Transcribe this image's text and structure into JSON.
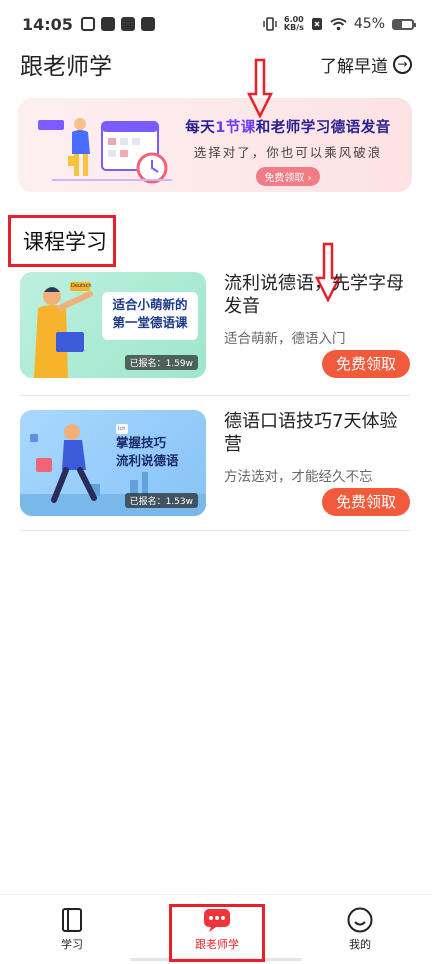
{
  "status": {
    "time": "14:05",
    "speed_value": "6.00",
    "speed_unit": "KB/s",
    "battery": "45%",
    "battery_level": 0.45
  },
  "header": {
    "title": "跟老师学",
    "morning_link": "了解早道"
  },
  "banner": {
    "headline_pre": "每天",
    "headline_highlight": "1节课",
    "headline_post": "和老师学习德语发音",
    "subline": "选择对了，你也可以乘风破浪",
    "button": "免费领取"
  },
  "section": {
    "title": "课程学习"
  },
  "courses": [
    {
      "title": "流利说德语，先学字母发音",
      "desc": "适合萌新，德语入门",
      "button": "免费领取",
      "thumb_line1": "适合小萌新的",
      "thumb_line2": "第一堂德语课",
      "thumb_enrolled": "已报名：1.59w",
      "thumb_tag": "Deutsch"
    },
    {
      "title": "德语口语技巧7天体验营",
      "desc": "方法选对，才能经久不忘",
      "button": "免费领取",
      "thumb_line1": "掌握技巧",
      "thumb_line2": "流利说德语",
      "thumb_enrolled": "已报名：1.53w",
      "thumb_tag": "Ich"
    }
  ],
  "nav": {
    "study": "学习",
    "teacher": "跟老师学",
    "mine": "我的"
  },
  "colors": {
    "accent_red": "#e8202a",
    "button_orange": "#f25a3c",
    "banner_navy": "#2a2090"
  }
}
